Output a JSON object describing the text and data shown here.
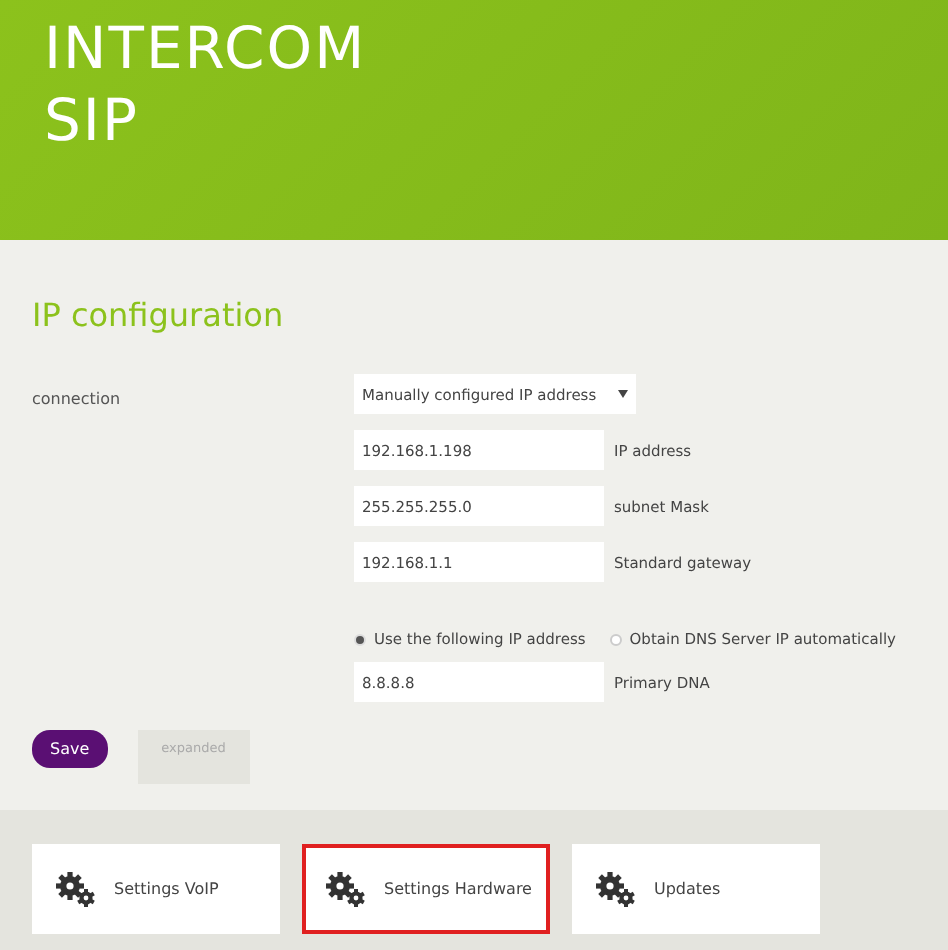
{
  "header": {
    "title": "INTERCOM SIP"
  },
  "section": {
    "title": "IP configuration"
  },
  "connection": {
    "label": "connection",
    "value": "Manually configured IP address"
  },
  "fields": [
    {
      "value": "192.168.1.198",
      "label": "IP address"
    },
    {
      "value": "255.255.255.0",
      "label": "subnet Mask"
    },
    {
      "value": "192.168.1.1",
      "label": "Standard gateway"
    }
  ],
  "radios": [
    {
      "label": "Use the following IP address",
      "selected": true
    },
    {
      "label": "Obtain DNS Server IP automatically",
      "selected": false
    }
  ],
  "dns_fields": [
    {
      "value": "8.8.8.8",
      "label": "Primary DNA"
    }
  ],
  "save_button": "Save",
  "expanded_tab": "expanded",
  "cards": [
    {
      "label": "Settings VoIP",
      "selected": false
    },
    {
      "label": "Settings Hardware",
      "selected": true
    },
    {
      "label": "Updates",
      "selected": false
    }
  ]
}
